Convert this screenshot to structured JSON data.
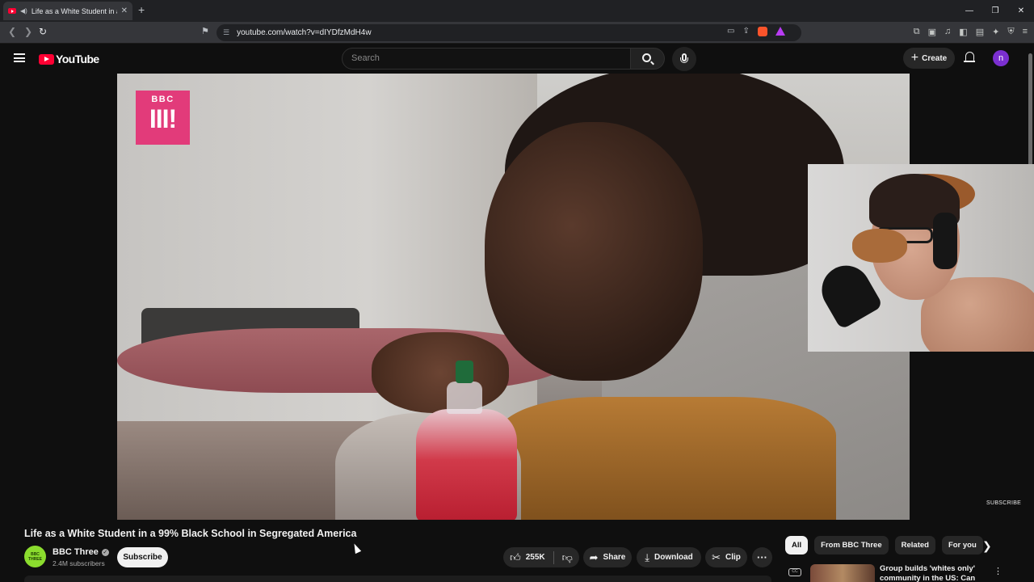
{
  "browser": {
    "tab_title": "Life as a White Student in a 99",
    "tab_close": "✕",
    "new_tab": "+",
    "url": "youtube.com/watch?v=dIYDfzMdH4w",
    "window_controls": [
      "—",
      "❐",
      "✕"
    ]
  },
  "youtube_header": {
    "logo_text": "YouTube",
    "search_placeholder": "Search",
    "create_label": "Create",
    "avatar_letter": "n"
  },
  "video": {
    "watermark_bbc": "BBC",
    "watermark_three": "III!",
    "subscribe_watermark": "SUBSCRIBE",
    "title": "Life as a White Student in a 99% Black School in Segregated America"
  },
  "channel": {
    "name": "BBC Three",
    "subscribers": "2.4M subscribers",
    "avatar_text": "BBC THREE",
    "subscribe_label": "Subscribe"
  },
  "actions": {
    "like_count": "255K",
    "share_label": "Share",
    "download_label": "Download",
    "clip_label": "Clip",
    "more_label": "···"
  },
  "recommendations": {
    "chips": [
      "All",
      "From BBC Three",
      "Related",
      "For you"
    ],
    "first_title": "Group builds 'whites only' community in the US: Can they"
  }
}
